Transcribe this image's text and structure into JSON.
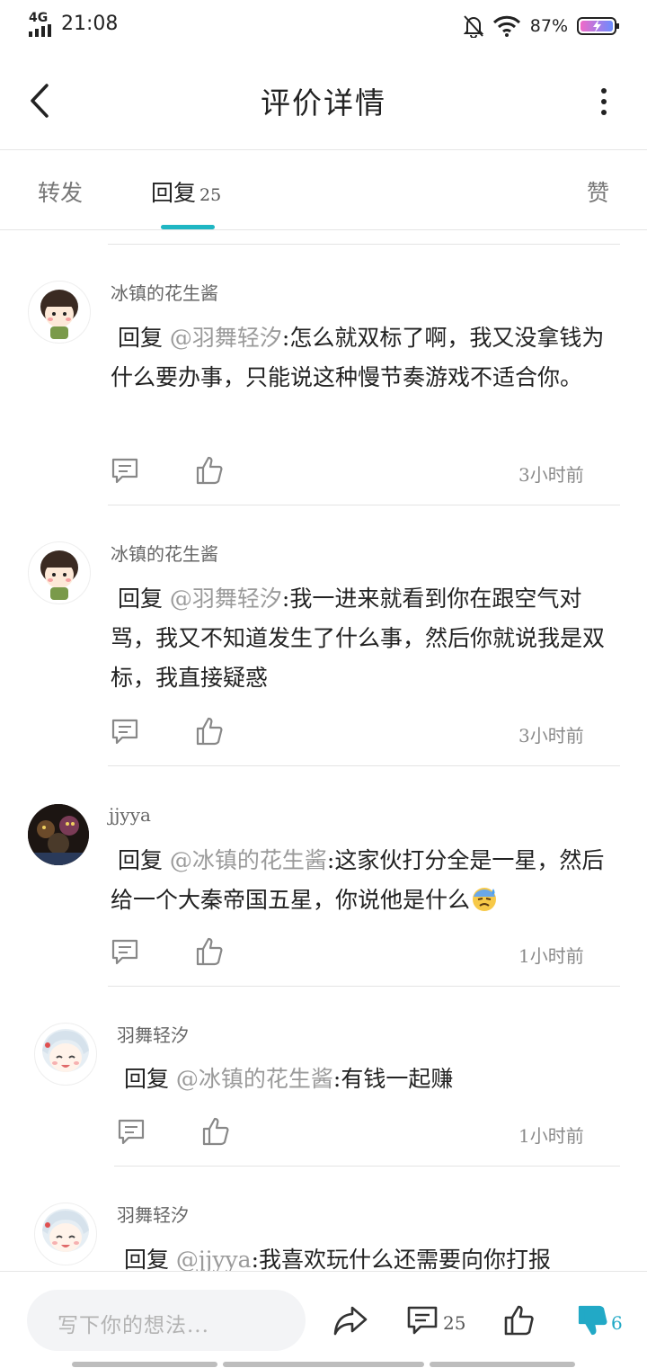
{
  "status_bar": {
    "network": "4G",
    "time": "21:08",
    "battery": "87%"
  },
  "header": {
    "title": "评价详情"
  },
  "tabs": {
    "forward": "转发",
    "reply": "回复",
    "reply_count": "25",
    "like": "赞"
  },
  "comments": [
    {
      "user": "冰镇的花生酱",
      "prefix": "回复 ",
      "mention": "@羽舞轻汐",
      "text": ":怎么就双标了啊，我又没拿钱为什么要办事，只能说这种慢节奏游戏不适合你。",
      "time": "3小时前"
    },
    {
      "user": "冰镇的花生酱",
      "prefix": "回复 ",
      "mention": "@羽舞轻汐",
      "text": ":我一进来就看到你在跟空气对骂，我又不知道发生了什么事，然后你就说我是双标，我直接疑惑",
      "time": "3小时前"
    },
    {
      "user": "jjyya",
      "prefix": "回复 ",
      "mention": "@冰镇的花生酱",
      "text": ":这家伙打分全是一星，然后给一个大秦帝国五星，你说他是什么",
      "time": "1小时前"
    },
    {
      "user": "羽舞轻汐",
      "prefix": "回复 ",
      "mention": "@冰镇的花生酱",
      "text": ":有钱一起赚",
      "time": "1小时前"
    },
    {
      "user": "羽舞轻汐",
      "prefix": "回复 ",
      "mention": "@jjyya",
      "text": ":我喜欢玩什么还需要向你打报",
      "time": ""
    }
  ],
  "bottom_bar": {
    "placeholder": "写下你的想法...",
    "comment_count": "25",
    "dislike_count": "6"
  },
  "colors": {
    "accent": "#1fb6c3",
    "dislike": "#22a9c6"
  },
  "icons": [
    "back-arrow-icon",
    "more-icon",
    "comment-icon",
    "thumbs-up-icon",
    "share-icon",
    "thumbs-down-icon",
    "emoji-sweat-icon"
  ]
}
